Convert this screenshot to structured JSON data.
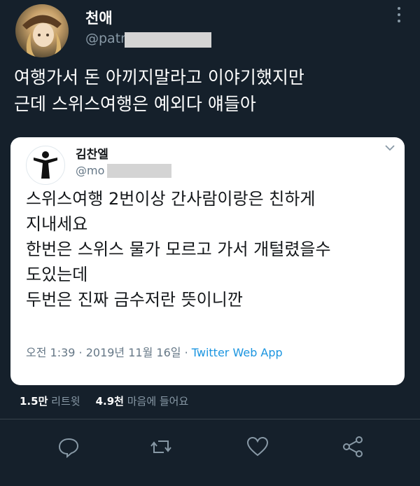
{
  "tweet": {
    "author_name": "천애",
    "handle": "@patr",
    "text_lines": [
      "여행가서 돈 아끼지말라고 이야기했지만",
      "근데 스위스여행은 예외다 얘들아"
    ],
    "stats": {
      "retweets_count": "1.5만",
      "retweets_label": "리트윗",
      "likes_count": "4.9천",
      "likes_label": "마음에 들어요"
    }
  },
  "quoted": {
    "author_name": "김찬엘",
    "handle": "@mo",
    "text_lines": [
      "스위스여행 2번이상 간사람이랑은 친하게",
      "지내세요",
      "한번은 스위스 물가 모르고 가서 개털렸을수",
      "도있는데",
      "두번은 진짜 금수저란 뜻이니깐"
    ],
    "timestamp": "오전 1:39 · 2019년 11월 16일 · ",
    "source": "Twitter Web App"
  },
  "icons": [
    "more-icon",
    "chevron-down-icon",
    "reply-icon",
    "retweet-icon",
    "like-icon",
    "share-icon"
  ],
  "colors": {
    "background": "#15202b",
    "muted": "#8899a6",
    "link": "#1b95e0",
    "card": "#ffffff"
  }
}
